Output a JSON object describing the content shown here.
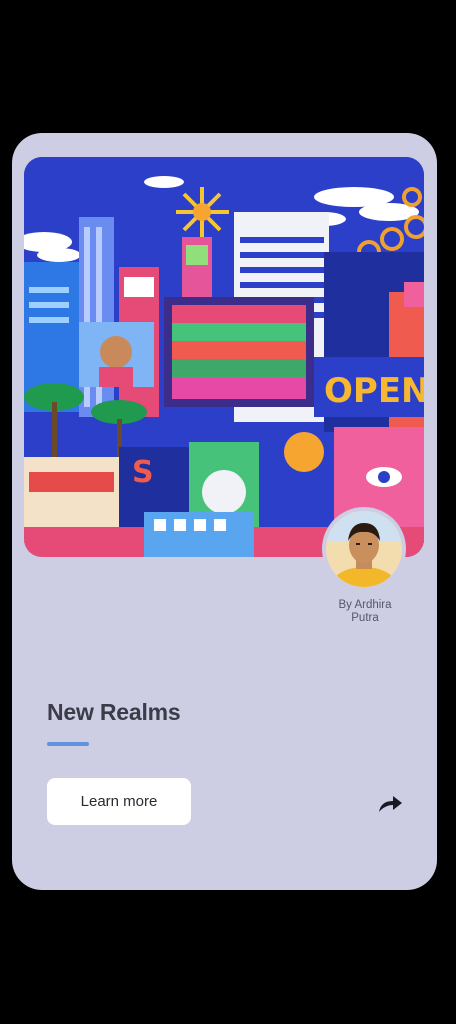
{
  "card": {
    "title": "New Realms",
    "author_line1": "By Ardhira",
    "author_line2": "Putra",
    "learn_more_label": "Learn more"
  },
  "icons": {
    "share": "share-arrow-icon",
    "avatar": "avatar",
    "artwork": "artwork-image"
  },
  "colors": {
    "background": "#000000",
    "card": "#cdcde4",
    "accent_underline": "#5f91dc",
    "button": "#ffffff",
    "title_text": "#3c3c48"
  }
}
